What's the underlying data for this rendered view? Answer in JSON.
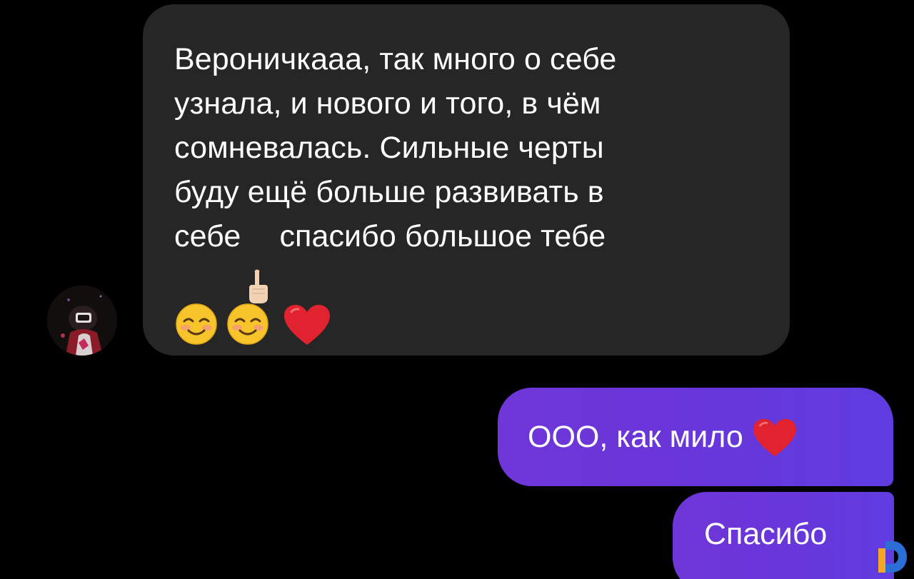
{
  "messages": {
    "incoming": {
      "text": "Вероничкааа, так много о себе\nузнала, и нового и того, в чём\nсомневалась. Сильные черты\nбуду ещё больше развивать в\nсебе",
      "text_after_point": "  спасибо большое тебе",
      "emoji": [
        "pointing-up-emoji",
        "smiling-face-emoji",
        "smiling-face-emoji",
        "red-heart-emoji"
      ]
    },
    "outgoing": [
      {
        "text": "ООО, как мило",
        "emoji": "red-heart-emoji"
      },
      {
        "text": "Спасибо"
      }
    ]
  },
  "colors": {
    "background": "#000000",
    "incoming_bubble": "#262626",
    "outgoing_bubble": "#6a35d9",
    "text": "#ffffff",
    "heart": "#e0232e",
    "smile_face": "#f7c52b"
  }
}
